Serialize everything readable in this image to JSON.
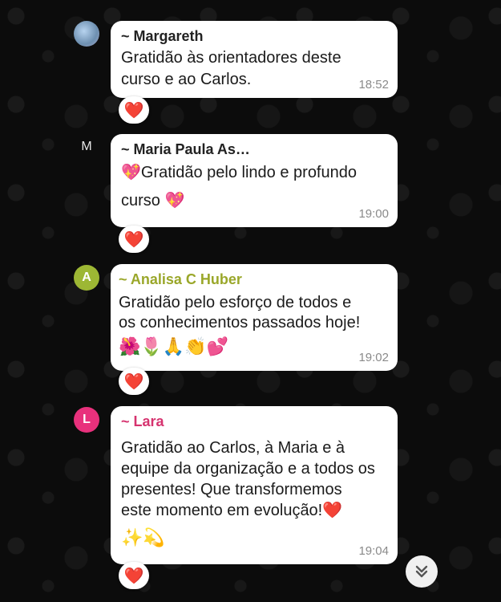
{
  "messages": [
    {
      "avatar": "",
      "avatar_icon": "profile-photo",
      "sender": "~ Margareth",
      "sender_color": "#222222",
      "text": "Gratidão às orientadores deste curso e ao Carlos.",
      "emojis": "",
      "time": "18:52",
      "reaction": "❤️"
    },
    {
      "avatar": "M",
      "sender": "~ Maria Paula As…",
      "sender_color": "#222222",
      "text": "💖Gratidão pelo lindo e profundo curso 💖",
      "emojis": "",
      "time": "19:00",
      "reaction": "❤️"
    },
    {
      "avatar": "A",
      "avatar_color": "#9db734",
      "sender": "~ Analisa C Huber",
      "sender_color": "#9aa72a",
      "text": "Gratidão pelo esforço de todos e os conhecimentos passados hoje!",
      "emojis": "🌺🌷🙏👏💕",
      "time": "19:02",
      "reaction": "❤️"
    },
    {
      "avatar": "L",
      "avatar_color": "#e8317c",
      "sender": "~ Lara",
      "sender_color": "#d6336f",
      "text": "Gratidão ao Carlos, à Maria e à equipe da organização e a todos os presentes! Que transformemos este momento em evolução!❤️",
      "emojis": "✨💫",
      "time": "19:04",
      "reaction": "❤️"
    }
  ],
  "scroll_button_icon": "chevron-double-down-icon"
}
